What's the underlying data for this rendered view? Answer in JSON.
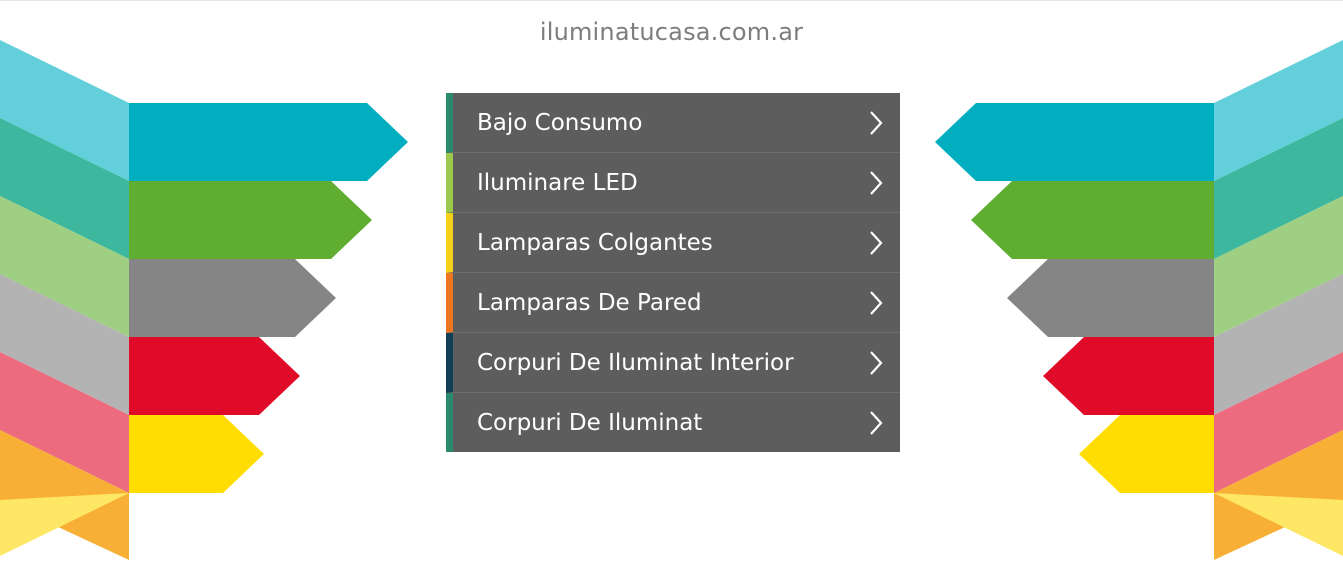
{
  "site": {
    "domain": "iluminatucasa.com.ar"
  },
  "menu": {
    "items": [
      {
        "label": "Bajo Consumo",
        "accent": "#2a8a6e",
        "icon": "chevron-right-icon"
      },
      {
        "label": "Iluminare LED",
        "accent": "#9cc84b",
        "icon": "chevron-right-icon"
      },
      {
        "label": "Lamparas Colgantes",
        "accent": "#f5d11a",
        "icon": "chevron-right-icon"
      },
      {
        "label": "Lamparas De Pared",
        "accent": "#ee7520",
        "icon": "chevron-right-icon"
      },
      {
        "label": "Corpuri De Iluminat Interior",
        "accent": "#123e56",
        "icon": "chevron-right-icon"
      },
      {
        "label": "Corpuri De Iluminat",
        "accent": "#2a8a6e",
        "icon": "chevron-right-icon"
      }
    ]
  },
  "decor": {
    "colors": [
      "#00aebf",
      "#5fae32",
      "#858585",
      "#e00b29",
      "#ffdd00"
    ],
    "faded_colors": [
      "#62cfda",
      "#3db89f",
      "#9fcf82",
      "#b3b3b3",
      "#ed6b7e",
      "#f7b035",
      "#fde764"
    ]
  }
}
